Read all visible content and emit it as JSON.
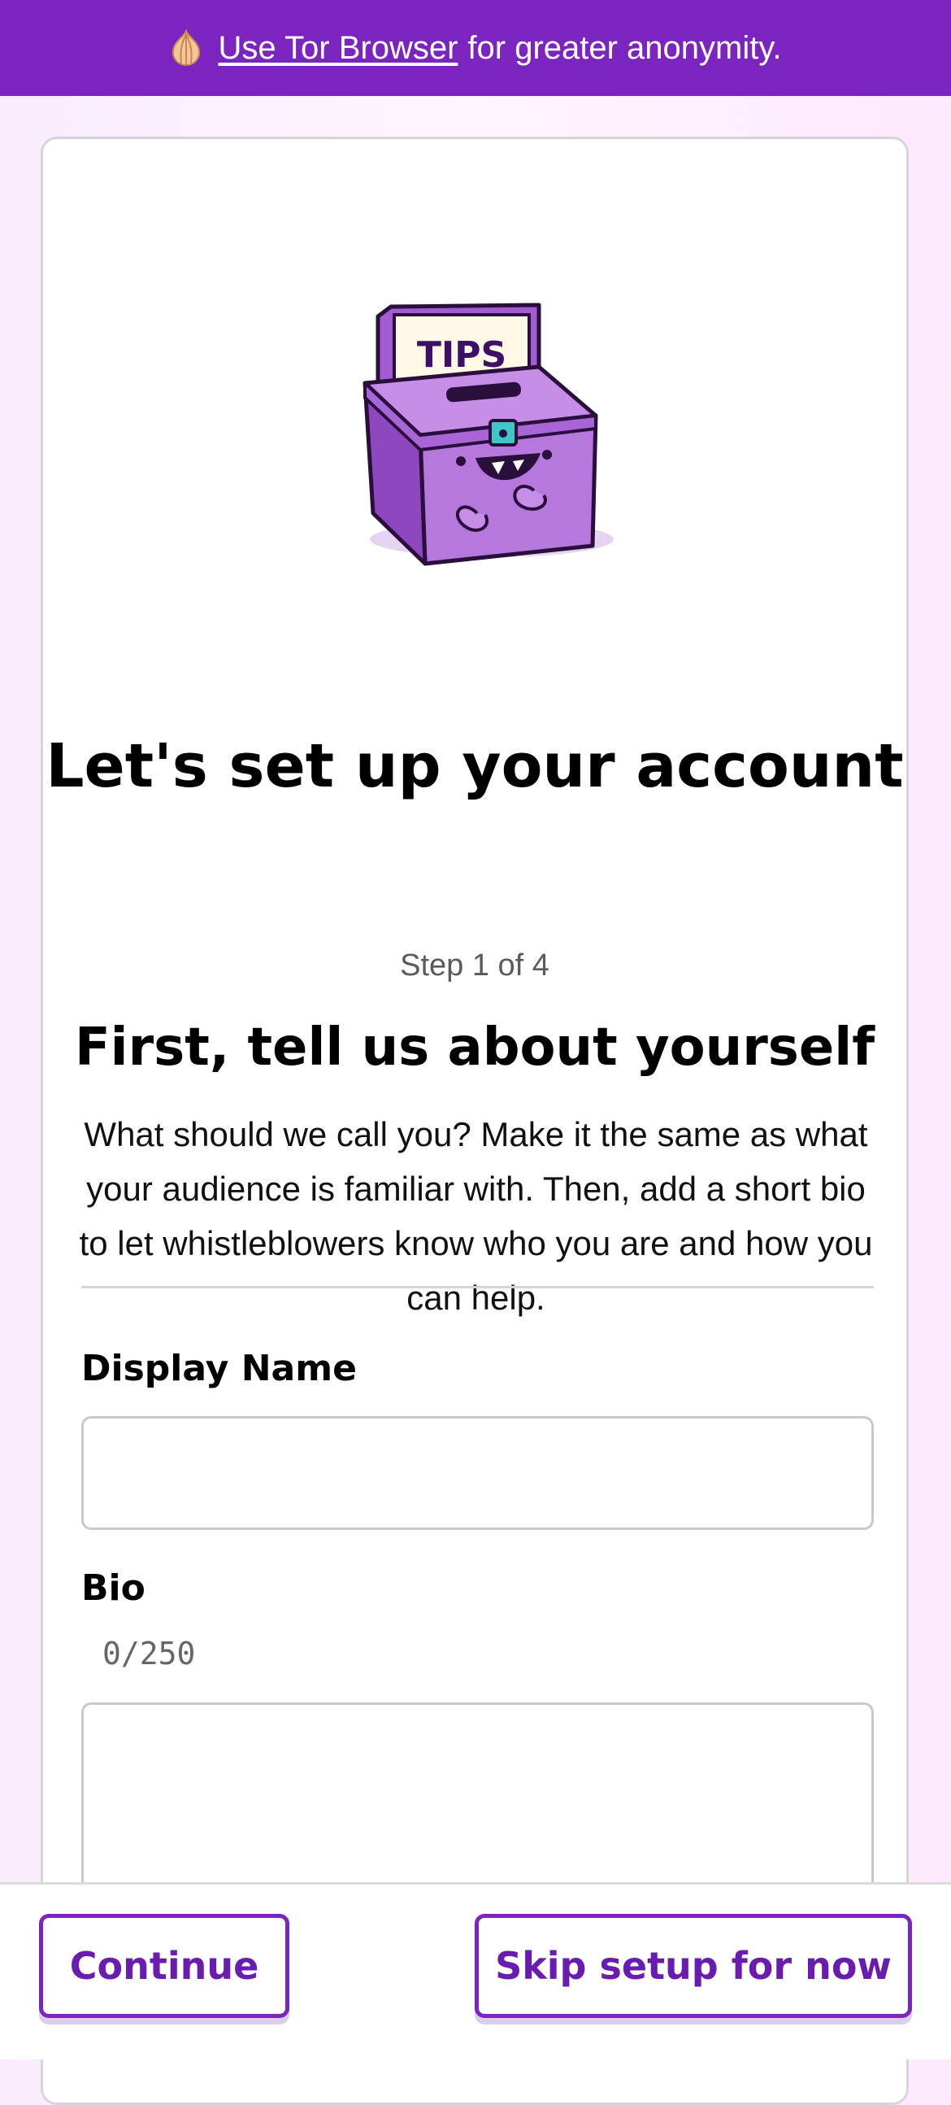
{
  "banner": {
    "link_text": "Use Tor Browser",
    "suffix_text": "for greater anonymity."
  },
  "mascot": {
    "sign_text": "TIPS"
  },
  "card": {
    "title": "Let's set up your account",
    "step_text": "Step 1 of 4",
    "subtitle": "First, tell us about yourself",
    "description": "What should we call you? Make it the same as what your audience is familiar with. Then, add a short bio to let whistleblowers know who you are and how you can help."
  },
  "form": {
    "display_name_label": "Display Name",
    "display_name_value": "",
    "bio_label": "Bio",
    "bio_counter": "0/250",
    "bio_value": ""
  },
  "footer": {
    "continue_label": "Continue",
    "skip_label": "Skip setup for now"
  },
  "colors": {
    "accent": "#7b24c0",
    "button_text": "#6a1bb0"
  }
}
